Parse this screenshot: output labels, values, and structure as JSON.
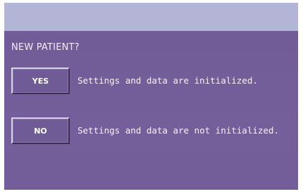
{
  "header": {
    "prompt": "NEW PATIENT?"
  },
  "options": [
    {
      "button_label": "YES",
      "description": "Settings and data are initialized."
    },
    {
      "button_label": "NO",
      "description": "Settings and data are not initialized."
    }
  ],
  "colors": {
    "title_strip": "#b3b5d6",
    "panel": "#735e9a",
    "text": "#f5f3fa"
  }
}
